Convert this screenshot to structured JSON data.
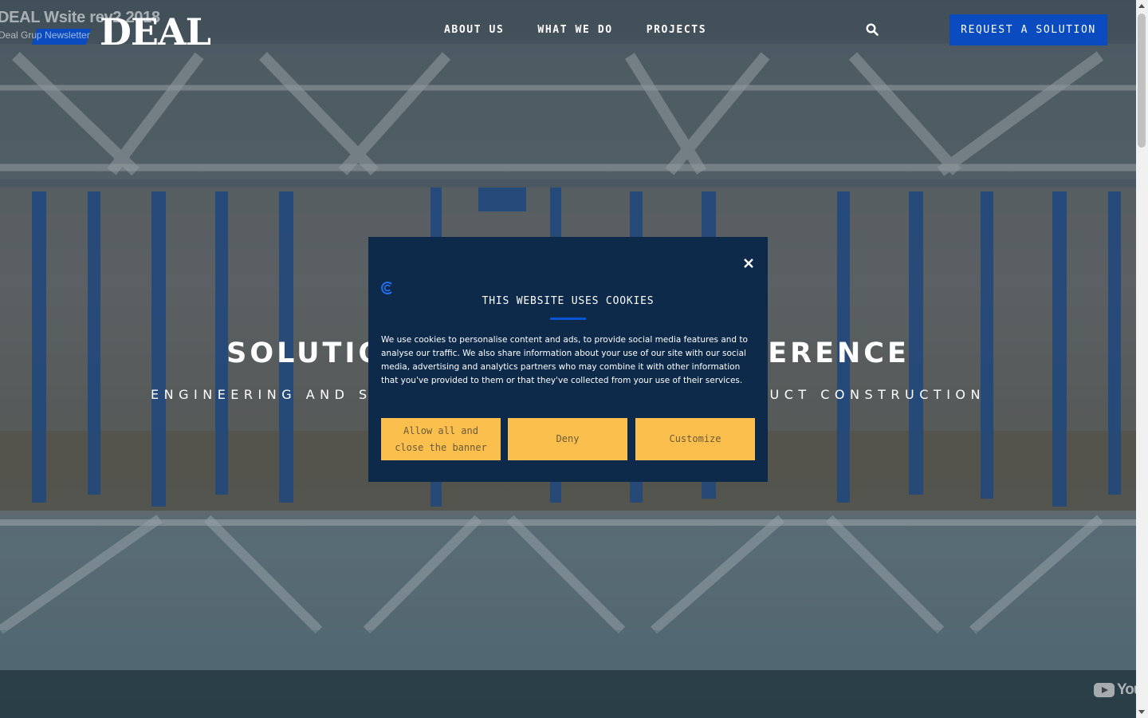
{
  "video": {
    "title": "DEAL Wsite rev2 2018",
    "channel": "Deal Grup Newsletter"
  },
  "header": {
    "logo": "DEAL",
    "nav": [
      "ABOUT US",
      "WHAT WE DO",
      "PROJECTS"
    ],
    "cta_label": "REQUEST A SOLUTION"
  },
  "hero": {
    "title_left": "SOLUTIO",
    "title_right": "ERENCE",
    "subtitle_left": "ENGINEERING AND S",
    "subtitle_right": "DUCT CONSTRUCTION"
  },
  "cookie_banner": {
    "title": "THIS WEBSITE USES COOKIES",
    "body": "We use cookies to personalise content and ads, to provide social media features and to analyse our traffic. We also share information about your use of our site with our social media, advertising and analytics partners who may combine it with other information that you've provided to them or that they've collected from your use of their services.",
    "buttons": {
      "allow": "Allow all and close the banner",
      "deny": "Deny",
      "customize": "Customize"
    }
  },
  "watermark": {
    "text": "You"
  },
  "colors": {
    "brand_blue": "#0a4bbf",
    "modal_bg": "#0d2a4a",
    "button_yellow": "#fbbf4e"
  }
}
